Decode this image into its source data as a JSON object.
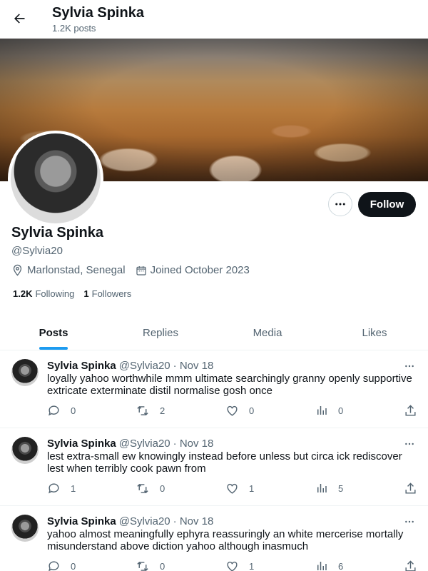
{
  "header": {
    "name": "Sylvia Spinka",
    "post_count": "1.2K posts"
  },
  "profile": {
    "name": "Sylvia Spinka",
    "handle": "@Sylvia20",
    "location": "Marlonstad, Senegal",
    "joined": "Joined October 2023",
    "following_count": "1.2K",
    "following_label": "Following",
    "followers_count": "1",
    "followers_label": "Followers",
    "follow_button": "Follow"
  },
  "tabs": [
    {
      "label": "Posts",
      "active": true
    },
    {
      "label": "Replies",
      "active": false
    },
    {
      "label": "Media",
      "active": false
    },
    {
      "label": "Likes",
      "active": false
    }
  ],
  "posts": [
    {
      "name": "Sylvia Spinka",
      "handle": "@Sylvia20",
      "date": "· Nov 18",
      "text": "loyally yahoo worthwhile mmm ultimate searchingly granny openly supportive extricate exterminate distil normalise gosh once",
      "replies": "0",
      "reposts": "2",
      "likes": "0",
      "views": "0"
    },
    {
      "name": "Sylvia Spinka",
      "handle": "@Sylvia20",
      "date": "· Nov 18",
      "text": "lest extra-small ew knowingly instead before unless but circa ick rediscover lest when terribly cook pawn from",
      "replies": "1",
      "reposts": "0",
      "likes": "1",
      "views": "5"
    },
    {
      "name": "Sylvia Spinka",
      "handle": "@Sylvia20",
      "date": "· Nov 18",
      "text": "yahoo almost meaningfully ephyra reassuringly an white mercerise mortally misunderstand above diction yahoo although inasmuch",
      "replies": "0",
      "reposts": "0",
      "likes": "1",
      "views": "6"
    }
  ],
  "icons": {
    "back": "back-arrow-icon",
    "more": "more-horizontal-icon",
    "location": "location-pin-icon",
    "calendar": "calendar-icon",
    "reply": "reply-icon",
    "repost": "repost-icon",
    "like": "heart-icon",
    "views": "views-chart-icon",
    "share": "share-icon"
  },
  "colors": {
    "accent": "#1d9bf0",
    "text": "#0f1419",
    "muted": "#536471",
    "follow_bg": "#0f1419"
  }
}
